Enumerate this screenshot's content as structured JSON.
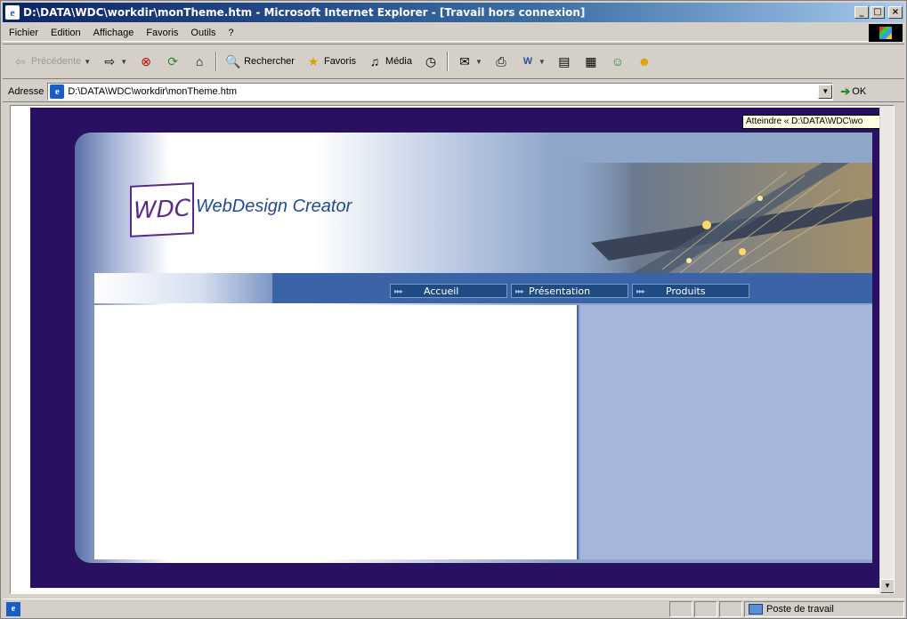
{
  "window": {
    "title": "D:\\DATA\\WDC\\workdir\\monTheme.htm - Microsoft Internet Explorer - [Travail hors connexion]",
    "buttons": {
      "minimize": "_",
      "maximize": "□",
      "close": "×"
    }
  },
  "menu": {
    "items": [
      "Fichier",
      "Edition",
      "Affichage",
      "Favoris",
      "Outils",
      "?"
    ]
  },
  "toolbar": {
    "back_label": "Précédente",
    "search_label": "Rechercher",
    "favorites_label": "Favoris",
    "media_label": "Média"
  },
  "address": {
    "label": "Adresse",
    "url": "D:\\DATA\\WDC\\workdir\\monTheme.htm",
    "go_label": "OK",
    "tooltip": "Atteindre « D:\\DATA\\WDC\\wo"
  },
  "page": {
    "logo_text": "WDC",
    "brand_name": "WebDesign Creator",
    "nav": [
      "Accueil",
      "Présentation",
      "Produits"
    ],
    "nav_arrows": "▸▸▸"
  },
  "status": {
    "zone_label": "Poste de travail"
  }
}
